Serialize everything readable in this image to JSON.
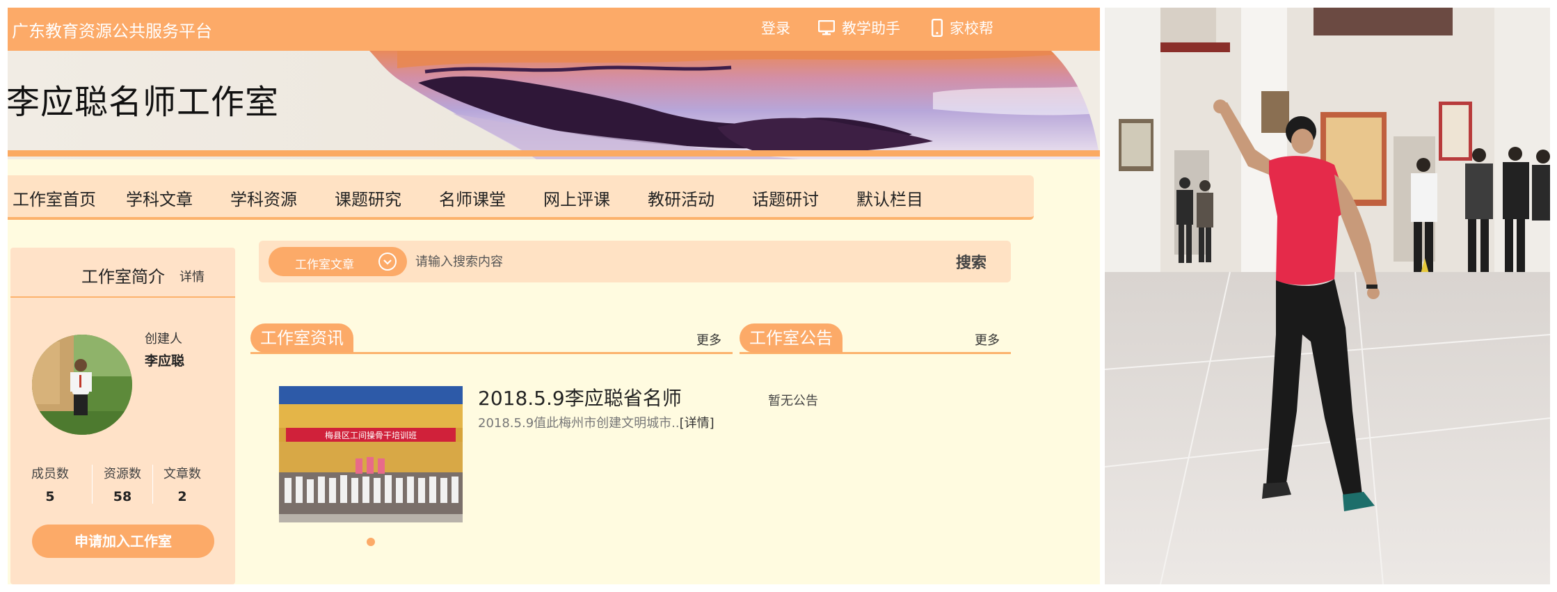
{
  "topbar": {
    "brand": "广东教育资源公共服务平台",
    "login": "登录",
    "assistant": "教学助手",
    "family": "家校帮"
  },
  "banner": {
    "title": "李应聪名师工作室"
  },
  "nav": {
    "items": [
      "工作室首页",
      "学科文章",
      "学科资源",
      "课题研究",
      "名师课堂",
      "网上评课",
      "教研活动",
      "话题研讨",
      "默认栏目"
    ]
  },
  "sidebar": {
    "title": "工作室简介",
    "details": "详情",
    "creator_label": "创建人",
    "creator_name": "李应聪",
    "stats": [
      {
        "label": "成员数",
        "value": "5"
      },
      {
        "label": "资源数",
        "value": "58"
      },
      {
        "label": "文章数",
        "value": "2"
      }
    ],
    "join_button": "申请加入工作室"
  },
  "search": {
    "category": "工作室文章",
    "placeholder": "请输入搜索内容",
    "button": "搜索"
  },
  "news": {
    "title": "工作室资讯",
    "more": "更多",
    "item_title": "2018.5.9李应聪省名师",
    "item_summary": "2018.5.9值此梅州市创建文明城市..",
    "item_details": "[详情]",
    "photo_banner_text": "梅县区工间操骨干培训班"
  },
  "notice": {
    "title": "工作室公告",
    "more": "更多",
    "empty": "暂无公告"
  },
  "colors": {
    "accent": "#fcaa68",
    "nav_bg": "#ffe2c4",
    "page_bg": "#fffbe0"
  }
}
